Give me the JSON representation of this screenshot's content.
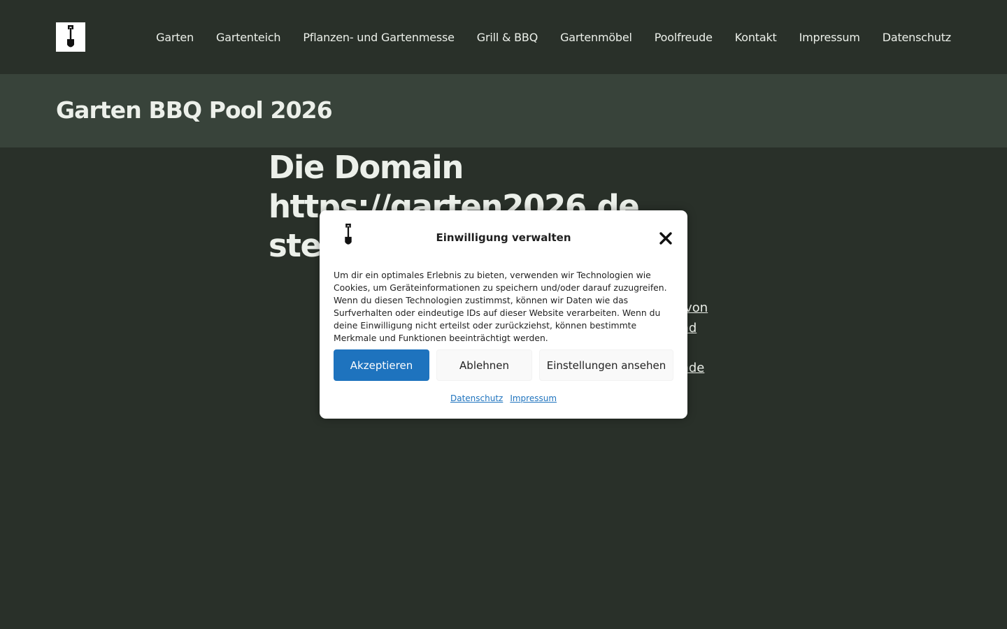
{
  "header": {
    "logo_icon": "shovel-icon",
    "nav": [
      {
        "label": "Garten"
      },
      {
        "label": "Gartenteich"
      },
      {
        "label": "Pflanzen- und Gartenmesse"
      },
      {
        "label": "Grill & BBQ"
      },
      {
        "label": "Gartenmöbel"
      },
      {
        "label": "Poolfreude"
      },
      {
        "label": "Kontakt"
      },
      {
        "label": "Impressum"
      },
      {
        "label": "Datenschutz"
      }
    ]
  },
  "title_bar": {
    "site_title": "Garten BBQ Pool 2026"
  },
  "main": {
    "heading_line1": "Die Domain",
    "heading_line2": "https://garten2026.de",
    "heading_line3": "stel",
    "visible_fragments": [
      "n von",
      "und",
      "unde"
    ]
  },
  "consent_modal": {
    "title": "Einwilligung verwalten",
    "logo_icon": "shovel-icon",
    "close_icon": "close-icon",
    "text": "Um dir ein optimales Erlebnis zu bieten, verwenden wir Technologien wie Cookies, um Geräteinformationen zu speichern und/oder darauf zuzugreifen. Wenn du diesen Technologien zustimmst, können wir Daten wie das Surfverhalten oder eindeutige IDs auf dieser Website verarbeiten. Wenn du deine Einwilligung nicht erteilst oder zurückziehst, können bestimmte Merkmale und Funktionen beeinträchtigt werden.",
    "accept_label": "Akzeptieren",
    "deny_label": "Ablehnen",
    "settings_label": "Einstellungen ansehen",
    "links": [
      {
        "label": "Datenschutz"
      },
      {
        "label": "Impressum"
      }
    ]
  },
  "colors": {
    "background": "#293029",
    "title_bar": "#38433a",
    "text": "#ecf0ea",
    "accent_button": "#1e73be"
  }
}
